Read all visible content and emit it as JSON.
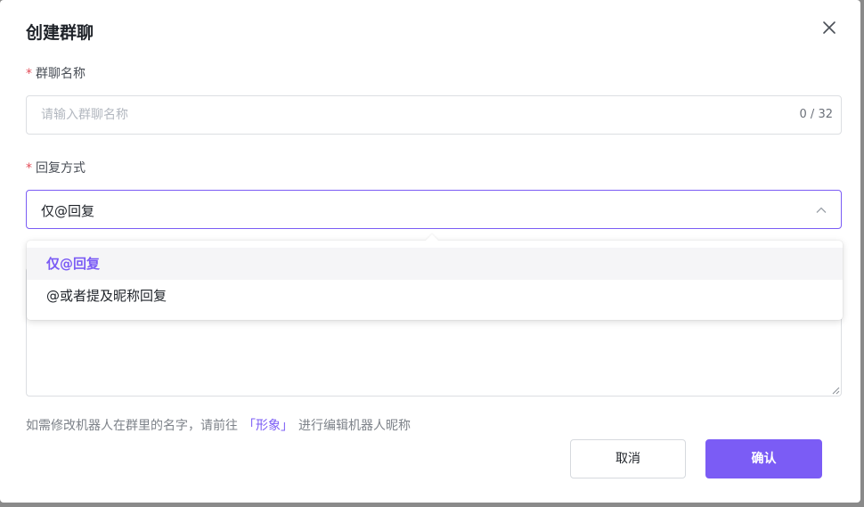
{
  "dialog": {
    "title": "创建群聊",
    "close_icon": "close-icon"
  },
  "group_name": {
    "required_mark": "*",
    "label": "群聊名称",
    "placeholder": "请输入群聊名称",
    "value": "",
    "counter": "0 / 32"
  },
  "reply_mode": {
    "required_mark": "*",
    "label": "回复方式",
    "selected": "仅@回复",
    "options": [
      {
        "label": "仅@回复",
        "selected": true
      },
      {
        "label": "@或者提及昵称回复",
        "selected": false
      }
    ]
  },
  "hint": {
    "prefix": "如需修改机器人在群里的名字，请前往",
    "link": "「形象」",
    "suffix": "进行编辑机器人昵称"
  },
  "footer": {
    "cancel_label": "取消",
    "confirm_label": "确认"
  },
  "colors": {
    "accent": "#7b5cf5",
    "required": "#e34d59"
  }
}
